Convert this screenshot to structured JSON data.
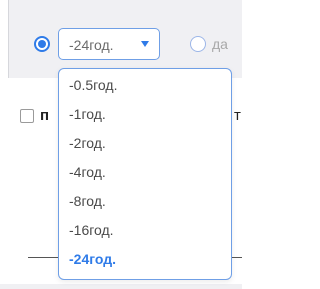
{
  "period_select": {
    "value": "-24год.",
    "options": [
      {
        "label": "-0.5год.",
        "selected": false
      },
      {
        "label": "-1год.",
        "selected": false
      },
      {
        "label": "-2год.",
        "selected": false
      },
      {
        "label": "-4год.",
        "selected": false
      },
      {
        "label": "-8год.",
        "selected": false
      },
      {
        "label": "-16год.",
        "selected": false
      },
      {
        "label": "-24год.",
        "selected": true
      }
    ]
  },
  "next_option": {
    "text": "да"
  },
  "background": {
    "label_left": "п",
    "label_right": "т"
  },
  "colors": {
    "accent": "#2f7be8",
    "border": "#6f9fe6",
    "panel": "#f0f0f3"
  }
}
